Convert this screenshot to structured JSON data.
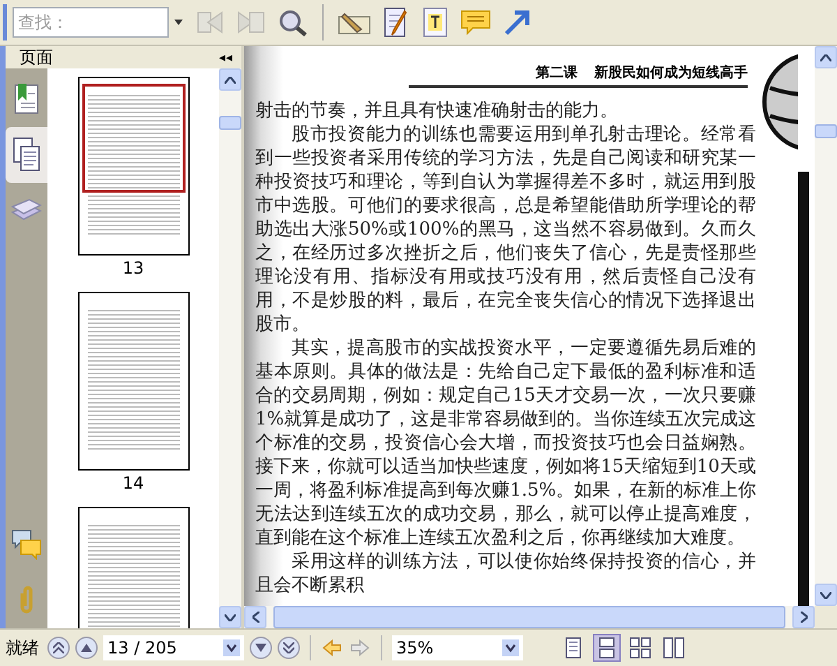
{
  "toolbar": {
    "search": {
      "placeholder": "查找："
    },
    "buttons": [
      {
        "kind": "find-prev",
        "disabled": true
      },
      {
        "kind": "find-next",
        "disabled": true
      },
      {
        "kind": "search",
        "disabled": false
      },
      {
        "kind": "pen",
        "disabled": false
      },
      {
        "kind": "note",
        "disabled": false
      },
      {
        "kind": "text",
        "disabled": false
      },
      {
        "kind": "comment",
        "disabled": false
      },
      {
        "kind": "arrow",
        "disabled": false
      }
    ]
  },
  "sidebar": {
    "title": "页面",
    "collapse": "◂◂",
    "tabs": [
      {
        "kind": "bookmarks",
        "selected": false
      },
      {
        "kind": "pages",
        "selected": true
      },
      {
        "kind": "layers",
        "selected": false
      },
      {
        "kind": "comments",
        "selected": false
      },
      {
        "kind": "attachments",
        "selected": false
      }
    ],
    "thumbnails": [
      {
        "label": "13",
        "selected": true
      },
      {
        "label": "14",
        "selected": false
      },
      {
        "selected": false
      }
    ]
  },
  "document": {
    "lesson": "第二课",
    "title": "新股民如何成为短线高手",
    "paragraphs": [
      {
        "indent": false,
        "text": "射击的节奏，并且具有快速准确射击的能力。"
      },
      {
        "indent": true,
        "text": "股市投资能力的训练也需要运用到单孔射击理论。经常看到一些投资者采用传统的学习方法，先是自己阅读和研究某一种投资技巧和理论，等到自认为掌握得差不多时，就运用到股市中选股。可他们的要求很高，总是希望能借助所学理论的帮助选出大涨50%或100%的黑马，这当然不容易做到。久而久之，在经历过多次挫折之后，他们丧失了信心，先是责怪那些理论没有用、指标没有用或技巧没有用，然后责怪自己没有用，不是炒股的料，最后，在完全丧失信心的情况下选择退出股市。"
      },
      {
        "indent": true,
        "text": "其实，提高股市的实战投资水平，一定要遵循先易后难的基本原则。具体的做法是：先给自己定下最低的盈利标准和适合的交易周期，例如：规定自己15天才交易一次，一次只要赚1%就算是成功了，这是非常容易做到的。当你连续五次完成这个标准的交易，投资信心会大增，而投资技巧也会日益娴熟。接下来，你就可以适当加快些速度，例如将15天缩短到10天或一周，将盈利标准提高到每次赚1.5%。如果，在新的标准上你无法达到连续五次的成功交易，那么，就可以停止提高难度，直到能在这个标准上连续五次盈利之后，你再继续加大难度。"
      },
      {
        "indent": true,
        "text": "采用这样的训练方法，可以使你始终保持投资的信心，并且会不断累积"
      }
    ]
  },
  "status_bar": {
    "status": "就绪",
    "page": "13 / 205",
    "zoom": "35%",
    "history": [
      {
        "kind": "back",
        "disabled": false
      },
      {
        "kind": "forward",
        "disabled": true
      }
    ],
    "view_modes": [
      {
        "kind": "single",
        "selected": false
      },
      {
        "kind": "continuous",
        "selected": true
      },
      {
        "kind": "facing",
        "selected": false
      },
      {
        "kind": "continuous-facing",
        "selected": false
      }
    ]
  }
}
